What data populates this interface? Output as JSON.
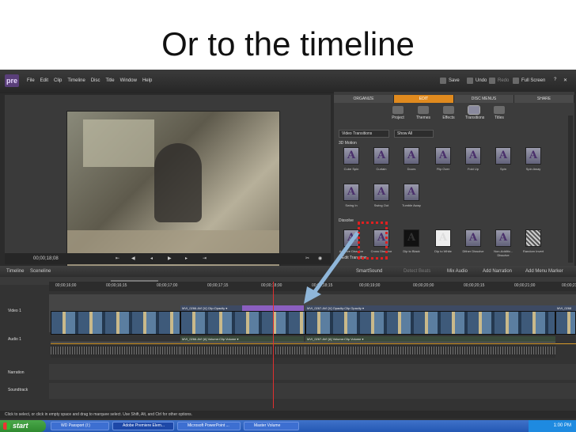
{
  "slide": {
    "title": "Or to the timeline"
  },
  "app": {
    "logo": "pre",
    "menu": [
      "File",
      "Edit",
      "Clip",
      "Timeline",
      "Disc",
      "Title",
      "Window",
      "Help"
    ],
    "top_buttons": {
      "save": "Save",
      "undo": "Undo",
      "redo": "Redo",
      "fullscreen": "Full Screen"
    },
    "monitor": {
      "timecode": "00;00;18;08"
    },
    "task_tabs": [
      "ORGANIZE",
      "EDIT",
      "DISC MENUS",
      "SHARE"
    ],
    "task_tools": [
      "Project",
      "Themes",
      "Effects",
      "Transitions",
      "Titles"
    ],
    "dropdowns": {
      "category": "Video Transitions",
      "filter": "Show All"
    },
    "sections": {
      "motion": "3D Motion",
      "dissolve": "Dissolve",
      "edit_transition": "Edit Transition"
    },
    "motion_row1": [
      "Cube Spin",
      "Curtain",
      "Doors",
      "Flip Over",
      "Fold Up",
      "Spin",
      "Spin Away"
    ],
    "motion_row2": [
      "Swing In",
      "Swing Out",
      "Tumble Away"
    ],
    "dissolve_row": [
      "Additive Dissolve",
      "Cross Dissolve",
      "Dip to Black",
      "Dip to White",
      "Dither Dissolve",
      "Non-Additiv... Dissolve",
      "Random Invert"
    ],
    "timeline_tabs": {
      "timeline": "Timeline",
      "sceneline": "Sceneline"
    },
    "timeline_tools": {
      "smartsound": "SmartSound",
      "detect_beats": "Detect Beats",
      "mix_audio": "Mix Audio",
      "add_narration": "Add Narration",
      "add_menu_marker": "Add Menu Marker"
    },
    "ruler": [
      "00;00;16;00",
      "00;00;16;15",
      "00;00;17;00",
      "00;00;17;15",
      "00;00;18;00",
      "00;00;18;15",
      "00;00;19;00",
      "00;00;20;00",
      "00;00;20;15",
      "00;00;21;00",
      "00;00;21;15"
    ],
    "tracks": [
      "Video 1",
      "Audio 1",
      "Narration",
      "Soundtrack"
    ],
    "clips": {
      "v1a": "MVI_0266.AVI [V] Clip:Opacity ▾",
      "v1b": "MVI_0267.AVI [V] Opacity:Clip Opacity ▾",
      "v1c": "MVI_0268",
      "a1a": "MVI_0266.AVI [A] Volume:Clip Volume ▾",
      "a1b": "MVI_0267.AVI [A] Volume:Clip Volume ▾"
    },
    "status": "Click to select, or click in empty space and drag to marquee select. Use Shift, Alt, and Ctrl for other options."
  },
  "taskbar": {
    "start": "start",
    "tasks": [
      "WD Passport (I:)",
      "Adobe Premiere Elem...",
      "Microsoft PowerPoint ...",
      "Master Volume"
    ],
    "clock": "1:00 PM"
  },
  "colors": {
    "accent_tab": "#e08a1e",
    "highlight_box": "#e02020",
    "arrow": "#8fb6d9"
  }
}
